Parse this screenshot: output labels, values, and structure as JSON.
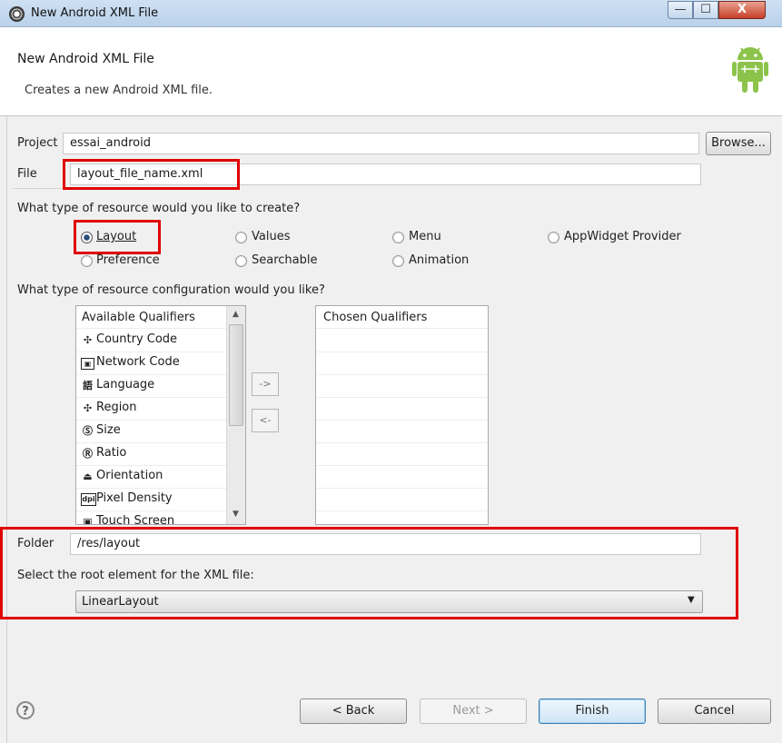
{
  "window": {
    "title": "New Android XML File",
    "min_symbol": "—",
    "max_symbol": "☐",
    "close_symbol": "X"
  },
  "header": {
    "title": "New Android XML File",
    "description": "Creates a new Android XML file."
  },
  "project": {
    "label": "Project",
    "value": "essai_android",
    "browse_label": "Browse..."
  },
  "file": {
    "label": "File",
    "value": "layout_file_name.xml"
  },
  "resource_type": {
    "question": "What type of resource would you like to create?",
    "options": [
      "Layout",
      "Values",
      "Menu",
      "AppWidget Provider",
      "Preference",
      "Searchable",
      "Animation"
    ],
    "selected": "Layout"
  },
  "configuration": {
    "question": "What type of resource configuration would you like?",
    "available_header": "Available Qualifiers",
    "chosen_header": "Chosen Qualifiers",
    "available": [
      "Country Code",
      "Network Code",
      "Language",
      "Region",
      "Size",
      "Ratio",
      "Orientation",
      "Pixel Density",
      "Touch Screen"
    ],
    "available_icons": [
      "country-code-icon",
      "network-code-icon",
      "language-icon",
      "region-icon",
      "size-icon",
      "ratio-icon",
      "orientation-icon",
      "pixel-density-icon",
      "touch-screen-icon"
    ],
    "add_arrow": "->",
    "remove_arrow": "<-"
  },
  "folder": {
    "label": "Folder",
    "value": "/res/layout"
  },
  "root_element": {
    "label": "Select the root element for the XML file:",
    "value": "LinearLayout"
  },
  "buttons": {
    "help": "?",
    "back": "< Back",
    "next": "Next >",
    "finish": "Finish",
    "cancel": "Cancel"
  },
  "colors": {
    "highlight": "#e00000",
    "title_bar": "#c3d6ec",
    "finish_border": "#3c7fb1"
  }
}
